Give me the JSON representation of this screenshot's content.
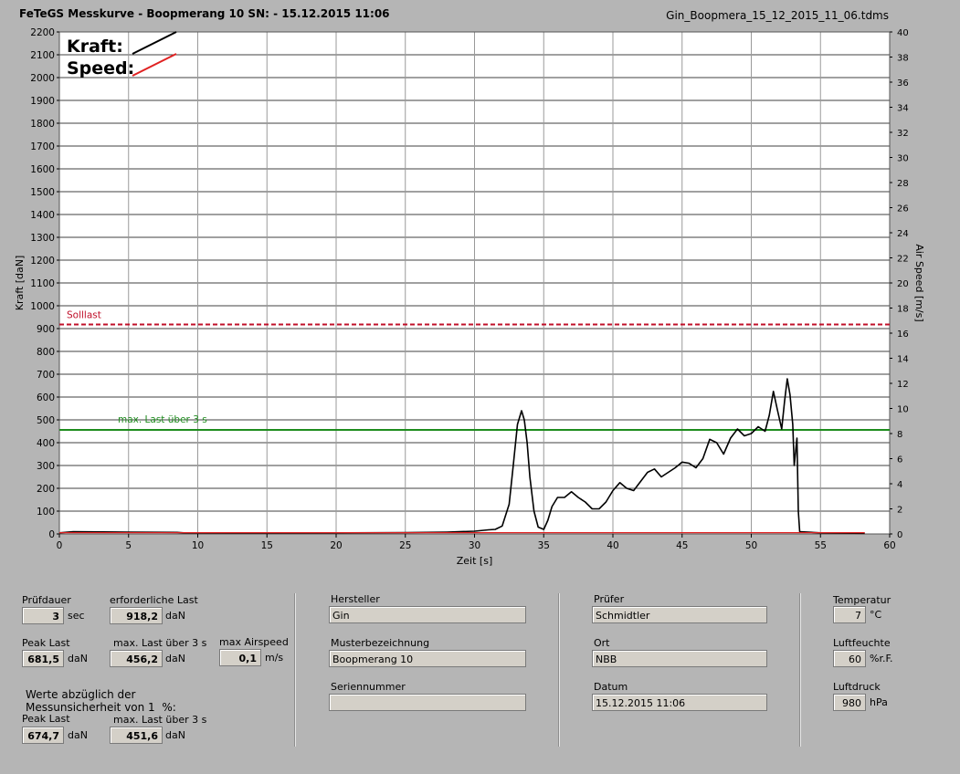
{
  "header": {
    "title": "FeTeGS Messkurve - Boopmerang 10  SN:  - 15.12.2015 11:06",
    "filename": "Gin_Boopmera_15_12_2015_11_06.tdms"
  },
  "chart_data": {
    "type": "line",
    "xlabel": "Zeit [s]",
    "ylabel": "Kraft [daN]",
    "y2label": "Air Speed [m/s]",
    "xlim": [
      0,
      60
    ],
    "ylim": [
      0,
      2200
    ],
    "y2lim": [
      0,
      40
    ],
    "x_ticks": [
      0,
      5,
      10,
      15,
      20,
      25,
      30,
      35,
      40,
      45,
      50,
      55,
      60
    ],
    "y_ticks": [
      0,
      100,
      200,
      300,
      400,
      500,
      600,
      700,
      800,
      900,
      1000,
      1100,
      1200,
      1300,
      1400,
      1500,
      1600,
      1700,
      1800,
      1900,
      2000,
      2100,
      2200
    ],
    "y2_ticks": [
      0,
      2,
      4,
      6,
      8,
      10,
      12,
      14,
      16,
      18,
      20,
      22,
      24,
      26,
      28,
      30,
      32,
      34,
      36,
      38,
      40
    ],
    "grid": true,
    "legend": [
      {
        "label": "Kraft:",
        "color": "#000000"
      },
      {
        "label": "Speed:",
        "color": "#e02020"
      }
    ],
    "reference_lines": [
      {
        "label": "Solllast",
        "value": 918.2,
        "color": "#c0102a",
        "style": "dashed"
      },
      {
        "label": "max. Last über  3 s",
        "value": 456.2,
        "color": "#1e8c1e",
        "style": "solid"
      }
    ],
    "series": [
      {
        "name": "Kraft",
        "color": "#000000",
        "x": [
          0,
          1,
          5,
          8.5,
          9,
          15,
          20,
          25,
          28,
          30,
          31,
          31.5,
          32,
          32.5,
          32.8,
          33.1,
          33.4,
          33.6,
          33.8,
          34,
          34.3,
          34.6,
          35,
          35.3,
          35.6,
          36,
          36.5,
          37,
          37.5,
          38,
          38.5,
          39,
          39.5,
          40,
          40.5,
          41,
          41.5,
          42,
          42.5,
          43,
          43.5,
          44,
          44.5,
          45,
          45.5,
          46,
          46.5,
          47,
          47.5,
          48,
          48.5,
          49,
          49.5,
          50,
          50.5,
          51,
          51.3,
          51.6,
          51.9,
          52.2,
          52.4,
          52.6,
          52.8,
          53,
          53.1,
          53.2,
          53.3,
          53.4,
          53.5,
          55,
          58.2
        ],
        "y": [
          5,
          10,
          8,
          7,
          5,
          4,
          5,
          6,
          8,
          12,
          18,
          20,
          35,
          130,
          300,
          480,
          540,
          500,
          400,
          250,
          100,
          30,
          20,
          60,
          120,
          160,
          160,
          185,
          160,
          140,
          110,
          110,
          140,
          190,
          225,
          200,
          190,
          230,
          270,
          285,
          250,
          270,
          290,
          315,
          310,
          290,
          330,
          415,
          400,
          350,
          420,
          460,
          430,
          440,
          470,
          450,
          520,
          625,
          540,
          460,
          580,
          680,
          610,
          480,
          300,
          360,
          420,
          100,
          10,
          5,
          3
        ]
      },
      {
        "name": "Speed",
        "color": "#e02020",
        "x": [
          0,
          58.2
        ],
        "y": [
          0.1,
          0.1
        ]
      }
    ]
  },
  "panel": {
    "pruefdauer": {
      "label": "Prüfdauer",
      "value": "3",
      "unit": "sec"
    },
    "erf_last": {
      "label": "erforderliche Last",
      "value": "918,2",
      "unit": "daN"
    },
    "peak_last": {
      "label": "Peak Last",
      "value": "681,5",
      "unit": "daN"
    },
    "max_last": {
      "label": "max. Last über  3 s",
      "value": "456,2",
      "unit": "daN"
    },
    "max_airspeed": {
      "label": "max Airspeed",
      "value": "0,1",
      "unit": "m/s"
    },
    "werte_note": "Werte abzüglich der\nMessunsicherheit von 1  %:",
    "peak_last2": {
      "label": "Peak Last",
      "value": "674,7",
      "unit": "daN"
    },
    "max_last2": {
      "label": "max. Last über  3 s",
      "value": "451,6",
      "unit": "daN"
    },
    "hersteller": {
      "label": "Hersteller",
      "value": "Gin"
    },
    "musterbezeichnung": {
      "label": "Musterbezeichnung",
      "value": "Boopmerang 10"
    },
    "seriennummer": {
      "label": "Seriennummer",
      "value": ""
    },
    "pruefer": {
      "label": "Prüfer",
      "value": "Schmidtler"
    },
    "ort": {
      "label": "Ort",
      "value": "NBB"
    },
    "datum": {
      "label": "Datum",
      "value": "15.12.2015 11:06"
    },
    "temperatur": {
      "label": "Temperatur",
      "value": "7",
      "unit": "°C"
    },
    "luftfeuchte": {
      "label": "Luftfeuchte",
      "value": "60",
      "unit": "%r.F."
    },
    "luftdruck": {
      "label": "Luftdruck",
      "value": "980",
      "unit": "hPa"
    }
  }
}
